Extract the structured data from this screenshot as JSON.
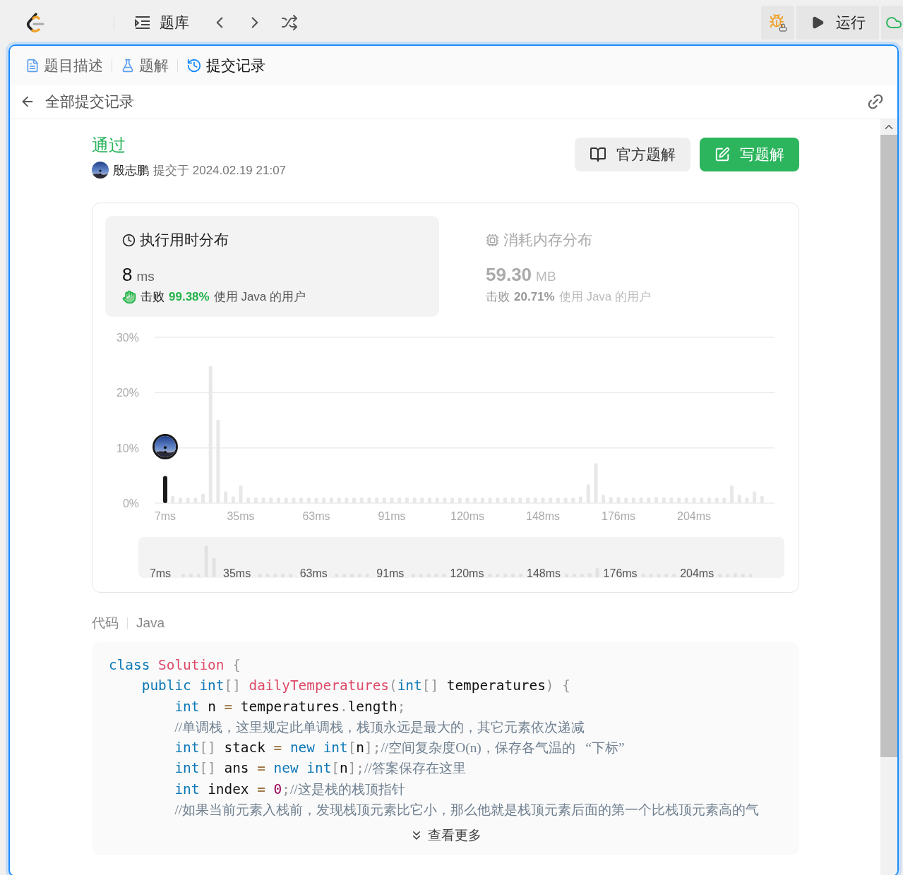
{
  "topbar": {
    "problem_bank": "题库",
    "run": "运行"
  },
  "tabs": [
    {
      "label": "题目描述",
      "kind": "description",
      "selected": false
    },
    {
      "label": "题解",
      "kind": "solutions",
      "selected": false
    },
    {
      "label": "提交记录",
      "kind": "submissions",
      "selected": true
    }
  ],
  "back_title": "全部提交记录",
  "submission": {
    "status": "通过",
    "user": "殷志鹏",
    "submitted_at": "提交于 2024.02.19 21:07"
  },
  "actions": [
    {
      "label": "官方题解",
      "kind": "secondary"
    },
    {
      "label": "写题解",
      "kind": "primary"
    }
  ],
  "stats": [
    {
      "kind": "runtime",
      "title": "执行用时分布",
      "value": "8",
      "unit": "ms",
      "beat": "击败",
      "percent": "99.38%",
      "suffix": "使用 Java 的用户",
      "selected": true
    },
    {
      "kind": "memory",
      "title": "消耗内存分布",
      "value": "59.30",
      "unit": "MB",
      "beat": "击败",
      "percent": "20.71%",
      "suffix": "使用 Java 的用户",
      "selected": false
    }
  ],
  "chart": {
    "chart_data": {
      "type": "bar",
      "categories": [
        "7ms",
        null,
        null,
        null,
        null,
        null,
        null,
        null,
        null,
        null,
        "35ms",
        null,
        null,
        null,
        null,
        null,
        null,
        null,
        null,
        null,
        "63ms",
        null,
        null,
        null,
        null,
        null,
        null,
        null,
        null,
        null,
        "91ms",
        null,
        null,
        null,
        null,
        null,
        null,
        null,
        null,
        null,
        "120ms",
        null,
        null,
        null,
        null,
        null,
        null,
        null,
        null,
        null,
        "148ms",
        null,
        null,
        null,
        null,
        null,
        null,
        null,
        null,
        null,
        "176ms",
        null,
        null,
        null,
        null,
        null,
        null,
        null,
        null,
        null,
        "204ms",
        null,
        null,
        null,
        null,
        null,
        null,
        null,
        null,
        null
      ],
      "series": [
        {
          "color": "#1a1a1a",
          "values": [
            4.9,
            null,
            null,
            null,
            null,
            null,
            null,
            null,
            null,
            null,
            null,
            null,
            null,
            null,
            null,
            null,
            null,
            null,
            null,
            null,
            null,
            null,
            null,
            null,
            null,
            null,
            null,
            null,
            null,
            null,
            null,
            null,
            null,
            null,
            null,
            null,
            null,
            null,
            null,
            null,
            null,
            null,
            null,
            null,
            null,
            null,
            null,
            null,
            null,
            null,
            null,
            null,
            null,
            null,
            null,
            null,
            null,
            null,
            null,
            null,
            null,
            null,
            null,
            null,
            null,
            null,
            null,
            null,
            null,
            null,
            null,
            null,
            null,
            null,
            null,
            null,
            null,
            null,
            null,
            null
          ]
        },
        {
          "color": "#e8e8e8",
          "values": [
            null,
            1.3,
            1.0,
            1.0,
            1.0,
            1.7,
            24.8,
            15.1,
            2.1,
            1.2,
            3.2,
            1.0,
            1.0,
            1.0,
            1.0,
            1.0,
            1.0,
            1.0,
            1.0,
            1.0,
            1.0,
            1.0,
            1.0,
            1.0,
            1.0,
            1.0,
            1.0,
            1.0,
            1.0,
            1.0,
            1.0,
            1.0,
            1.0,
            1.0,
            1.0,
            1.0,
            1.0,
            1.0,
            1.0,
            1.0,
            1.0,
            1.0,
            1.0,
            1.0,
            1.0,
            1.0,
            1.0,
            1.0,
            1.0,
            1.0,
            1.0,
            1.0,
            1.0,
            1.0,
            1.0,
            1.2,
            3.4,
            7.2,
            1.5,
            1.1,
            1.1,
            1.0,
            1.0,
            1.0,
            1.0,
            1.1,
            1.0,
            1.0,
            1.0,
            1.0,
            1.0,
            1.0,
            1.0,
            1.0,
            1.0,
            3.2,
            1.5,
            1.0,
            2.1,
            1.3
          ]
        }
      ],
      "ylim": [
        0,
        30
      ],
      "yticks": [
        {
          "value": 0,
          "label": "0%"
        },
        {
          "value": 10,
          "label": "10%"
        },
        {
          "value": 20,
          "label": "20%"
        },
        {
          "value": 30,
          "label": "30%"
        }
      ]
    }
  },
  "code": {
    "label": "代码",
    "language": "Java",
    "more": "查看更多",
    "lines": [
      [
        {
          "kind": "keyword",
          "text": "class"
        },
        {
          "kind": "type",
          "text": " Solution"
        },
        {
          "kind": "punct",
          "text": " {"
        }
      ],
      [
        {
          "kind": "keyword",
          "text": "    public"
        },
        {
          "kind": "keyword",
          "text": " int"
        },
        {
          "kind": "punct",
          "text": "[]"
        },
        {
          "kind": "type",
          "text": " dailyTemperatures"
        },
        {
          "kind": "punct",
          "text": "("
        },
        {
          "kind": "keyword",
          "text": "int"
        },
        {
          "kind": "punct",
          "text": "[]"
        },
        {
          "kind": "plain",
          "text": " temperatures"
        },
        {
          "kind": "punct",
          "text": ")"
        },
        {
          "kind": "punct",
          "text": " {"
        }
      ],
      [
        {
          "kind": "keyword",
          "text": "        int"
        },
        {
          "kind": "plain",
          "text": " n "
        },
        {
          "kind": "operator",
          "text": "="
        },
        {
          "kind": "plain",
          "text": " temperatures"
        },
        {
          "kind": "punct",
          "text": "."
        },
        {
          "kind": "plain",
          "text": "length"
        },
        {
          "kind": "punct",
          "text": ";"
        }
      ],
      [
        {
          "kind": "comment",
          "text": "        //单调栈，这里规定此单调栈，栈顶永远是最大的，其它元素依次递减"
        }
      ],
      [
        {
          "kind": "keyword",
          "text": "        int"
        },
        {
          "kind": "punct",
          "text": "[]"
        },
        {
          "kind": "plain",
          "text": " stack "
        },
        {
          "kind": "operator",
          "text": "="
        },
        {
          "kind": "keyword",
          "text": " new"
        },
        {
          "kind": "keyword",
          "text": " int"
        },
        {
          "kind": "punct",
          "text": "["
        },
        {
          "kind": "plain",
          "text": "n"
        },
        {
          "kind": "punct",
          "text": "];"
        },
        {
          "kind": "comment",
          "text": "//空间复杂度O(n)，保存各气温的   “下标”"
        }
      ],
      [
        {
          "kind": "keyword",
          "text": "        int"
        },
        {
          "kind": "punct",
          "text": "[]"
        },
        {
          "kind": "plain",
          "text": " ans "
        },
        {
          "kind": "operator",
          "text": "="
        },
        {
          "kind": "keyword",
          "text": " new"
        },
        {
          "kind": "keyword",
          "text": " int"
        },
        {
          "kind": "punct",
          "text": "["
        },
        {
          "kind": "plain",
          "text": "n"
        },
        {
          "kind": "punct",
          "text": "];"
        },
        {
          "kind": "comment",
          "text": "//答案保存在这里"
        }
      ],
      [
        {
          "kind": "keyword",
          "text": "        int"
        },
        {
          "kind": "plain",
          "text": " index "
        },
        {
          "kind": "operator",
          "text": "="
        },
        {
          "kind": "number",
          "text": " 0"
        },
        {
          "kind": "punct",
          "text": ";"
        },
        {
          "kind": "comment",
          "text": "//这是栈的栈顶指针"
        }
      ],
      [
        {
          "kind": "comment",
          "text": "        //如果当前元素入栈前，发现栈顶元素比它小，那么他就是栈顶元素后面的第一个比栈顶元素高的气"
        }
      ]
    ]
  }
}
